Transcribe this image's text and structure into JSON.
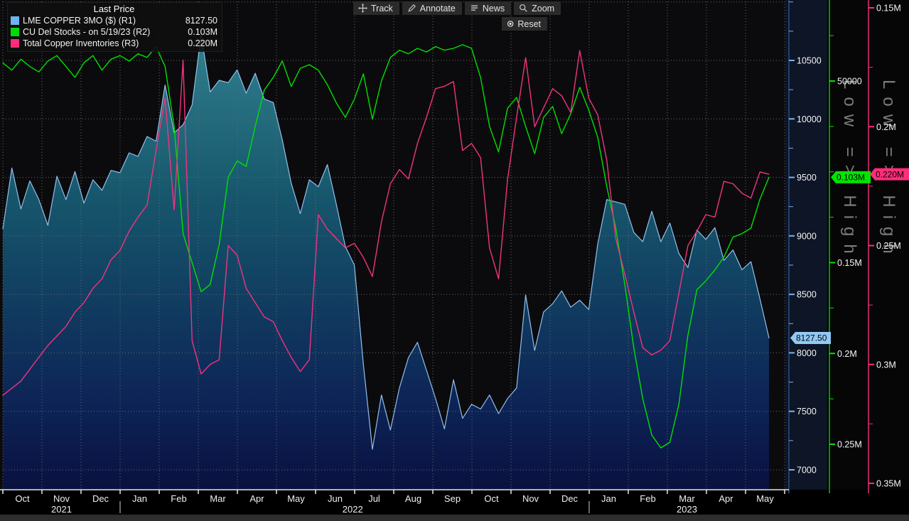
{
  "legend": {
    "title": "Last Price",
    "series": [
      {
        "label": "LME COPPER 3MO ($)  (R1)",
        "value": "8127.50",
        "color": "#6fb3f0"
      },
      {
        "label": "CU Del Stocks -  on 5/19/23  (R2)",
        "value": "0.103M",
        "color": "#00dd00"
      },
      {
        "label": "Total Copper Inventories  (R3)",
        "value": "0.220M",
        "color": "#ff2d78"
      }
    ]
  },
  "toolbar": {
    "buttons": [
      {
        "label": "Track"
      },
      {
        "label": "Annotate"
      },
      {
        "label": "News"
      },
      {
        "label": "Zoom"
      }
    ],
    "reset_label": "Reset"
  },
  "chart_data": {
    "type": "line",
    "watermark": "Low => High",
    "grid": {
      "color": "#6a6a6a",
      "on": true
    },
    "legend_position": "top-left",
    "x_axis": {
      "months": [
        "Oct",
        "Nov",
        "Dec",
        "Jan",
        "Feb",
        "Mar",
        "Apr",
        "May",
        "Jun",
        "Jul",
        "Aug",
        "Sep",
        "Oct",
        "Nov",
        "Dec",
        "Jan",
        "Feb",
        "Mar",
        "Apr",
        "May"
      ],
      "years": [
        {
          "label": "2021",
          "pos": 1.0
        },
        {
          "label": "2022",
          "pos": 8.45
        },
        {
          "label": "2023",
          "pos": 17.0
        }
      ],
      "year_dividers": [
        3,
        15
      ]
    },
    "axes": {
      "R1": {
        "x": 1110,
        "line_color": "#24406b",
        "tick_color": "#7fb2e8",
        "label_color": "#f5f5f5",
        "y_top": 85,
        "v_top": 10500,
        "y_bottom": 661,
        "v_bottom": 7000,
        "badge_w": 50,
        "ticks": [
          [
            11000,
            ""
          ],
          [
            10750,
            ""
          ],
          [
            10500,
            "10500"
          ],
          [
            10250,
            ""
          ],
          [
            10000,
            "10000"
          ],
          [
            9750,
            ""
          ],
          [
            9500,
            "9500"
          ],
          [
            9250,
            ""
          ],
          [
            9000,
            "9000"
          ],
          [
            8750,
            ""
          ],
          [
            8500,
            "8500"
          ],
          [
            8250,
            ""
          ],
          [
            8000,
            "8000"
          ],
          [
            7750,
            ""
          ],
          [
            7500,
            "7500"
          ],
          [
            7250,
            ""
          ],
          [
            7000,
            "7000"
          ]
        ]
      },
      "R2": {
        "x": 1167,
        "line_color": "#00c400",
        "tick_color": "#00e400",
        "label_color": "#f5f5f5",
        "y_top": 114,
        "v_top": 0.05,
        "y_bottom": 625,
        "v_bottom": 0.25,
        "badge_w": 49,
        "ticks": [
          [
            0.025,
            ""
          ],
          [
            0.05,
            "50000"
          ],
          [
            0.075,
            ""
          ],
          [
            0.1,
            ""
          ],
          [
            0.125,
            ""
          ],
          [
            0.15,
            "0.15M"
          ],
          [
            0.175,
            ""
          ],
          [
            0.2,
            "0.2M"
          ],
          [
            0.225,
            ""
          ],
          [
            0.25,
            "0.25M"
          ]
        ]
      },
      "R3": {
        "x": 1222,
        "line_color": "#e62e78",
        "tick_color": "#ff2e79",
        "label_color": "#f5f5f5",
        "y_top": 11,
        "v_top": 0.15,
        "y_bottom": 680,
        "v_bottom": 0.35,
        "badge_w": 52,
        "ticks": [
          [
            0.15,
            "0.15M"
          ],
          [
            0.175,
            ""
          ],
          [
            0.2,
            "0.2M"
          ],
          [
            0.225,
            ""
          ],
          [
            0.25,
            "0.25M"
          ],
          [
            0.275,
            ""
          ],
          [
            0.3,
            "0.3M"
          ],
          [
            0.325,
            ""
          ],
          [
            0.35,
            "0.35M"
          ]
        ]
      }
    },
    "series": [
      {
        "name": "LME COPPER 3MO ($)",
        "axis": "R1",
        "color": "#93bfeb",
        "area": true,
        "values": [
          9060,
          9580,
          9230,
          9470,
          9310,
          9090,
          9510,
          9310,
          9550,
          9280,
          9480,
          9390,
          9560,
          9540,
          9710,
          9680,
          9850,
          9810,
          10290,
          9880,
          9950,
          10120,
          10720,
          10230,
          10330,
          10310,
          10420,
          10220,
          10390,
          10170,
          10140,
          9820,
          9450,
          9190,
          9480,
          9420,
          9610,
          9270,
          8910,
          8750,
          7900,
          7175,
          7640,
          7340,
          7700,
          7960,
          8090,
          7850,
          7610,
          7350,
          7770,
          7440,
          7560,
          7520,
          7640,
          7480,
          7610,
          7700,
          8495,
          8020,
          8350,
          8420,
          8530,
          8390,
          8450,
          8370,
          8930,
          9310,
          9290,
          9270,
          9030,
          8950,
          9210,
          8950,
          9110,
          8850,
          8730,
          9050,
          8970,
          9070,
          8790,
          8880,
          8710,
          8780,
          8460,
          8127.5
        ]
      },
      {
        "name": "CU Del Stocks",
        "axis": "R2",
        "color": "#00e000",
        "values": [
          0.04,
          0.044,
          0.038,
          0.042,
          0.045,
          0.039,
          0.036,
          0.042,
          0.048,
          0.04,
          0.036,
          0.044,
          0.038,
          0.036,
          0.039,
          0.035,
          0.037,
          0.031,
          0.042,
          0.075,
          0.134,
          0.15,
          0.166,
          0.162,
          0.14,
          0.103,
          0.094,
          0.097,
          0.075,
          0.055,
          0.048,
          0.039,
          0.053,
          0.043,
          0.041,
          0.044,
          0.052,
          0.062,
          0.07,
          0.06,
          0.046,
          0.071,
          0.05,
          0.037,
          0.033,
          0.035,
          0.032,
          0.034,
          0.031,
          0.033,
          0.032,
          0.03,
          0.032,
          0.048,
          0.075,
          0.089,
          0.065,
          0.059,
          0.075,
          0.09,
          0.07,
          0.064,
          0.079,
          0.068,
          0.0535,
          0.066,
          0.081,
          0.108,
          0.131,
          0.162,
          0.197,
          0.225,
          0.245,
          0.252,
          0.249,
          0.228,
          0.19,
          0.165,
          0.16,
          0.154,
          0.147,
          0.136,
          0.134,
          0.131,
          0.115,
          0.103
        ]
      },
      {
        "name": "Total Copper Inventories",
        "axis": "R3",
        "color": "#f2337f",
        "values": [
          0.313,
          0.31,
          0.307,
          0.302,
          0.297,
          0.292,
          0.288,
          0.284,
          0.278,
          0.274,
          0.268,
          0.264,
          0.256,
          0.252,
          0.244,
          0.238,
          0.233,
          0.21,
          0.188,
          0.235,
          0.172,
          0.29,
          0.304,
          0.3,
          0.298,
          0.25,
          0.254,
          0.268,
          0.274,
          0.28,
          0.282,
          0.29,
          0.297,
          0.303,
          0.298,
          0.237,
          0.243,
          0.247,
          0.251,
          0.249,
          0.255,
          0.263,
          0.24,
          0.224,
          0.218,
          0.222,
          0.207,
          0.196,
          0.184,
          0.183,
          0.181,
          0.21,
          0.207,
          0.213,
          0.251,
          0.264,
          0.222,
          0.196,
          0.171,
          0.2,
          0.192,
          0.184,
          0.187,
          0.194,
          0.168,
          0.188,
          0.195,
          0.214,
          0.247,
          0.262,
          0.278,
          0.293,
          0.296,
          0.294,
          0.29,
          0.27,
          0.25,
          0.244,
          0.237,
          0.238,
          0.223,
          0.224,
          0.228,
          0.23,
          0.219,
          0.22
        ]
      }
    ],
    "badges": [
      {
        "axis": "R1",
        "value": 8127.5,
        "text": "8127.50",
        "bg": "#92c9f5",
        "fg": "#000000"
      },
      {
        "axis": "R2",
        "value": 0.103,
        "text": "0.103M",
        "bg": "#00e400",
        "fg": "#000000"
      },
      {
        "axis": "R3",
        "value": 0.22,
        "text": "0.220M",
        "bg": "#ff2e79",
        "fg": "#000000"
      }
    ],
    "layout": {
      "plot_left": 4,
      "plot_right": 1104,
      "plot_bottom": 689,
      "month_width": 55,
      "x_data_start": 4,
      "x_data_end": 1082,
      "xaxis_line_end": 1110
    }
  }
}
